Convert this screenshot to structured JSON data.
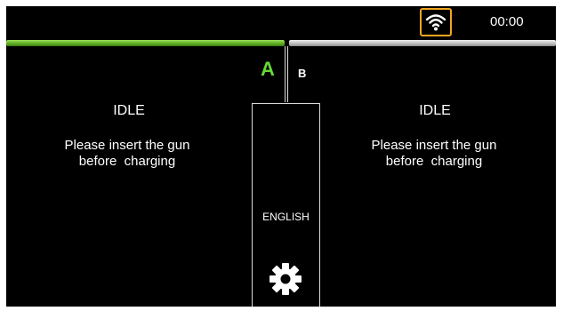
{
  "header": {
    "time": "00:00",
    "wifi_icon": "wifi-icon",
    "active_color": "#67d937",
    "wifi_border_color": "#f2a51f"
  },
  "connectors": {
    "a": {
      "label": "A",
      "status": "IDLE",
      "message_line1": "Please insert the gun",
      "message_line2": "before  charging"
    },
    "b": {
      "label": "B",
      "status": "IDLE",
      "message_line1": "Please insert the gun",
      "message_line2": "before  charging"
    }
  },
  "center": {
    "language_label": "ENGLISH",
    "settings_icon": "gear-icon"
  }
}
